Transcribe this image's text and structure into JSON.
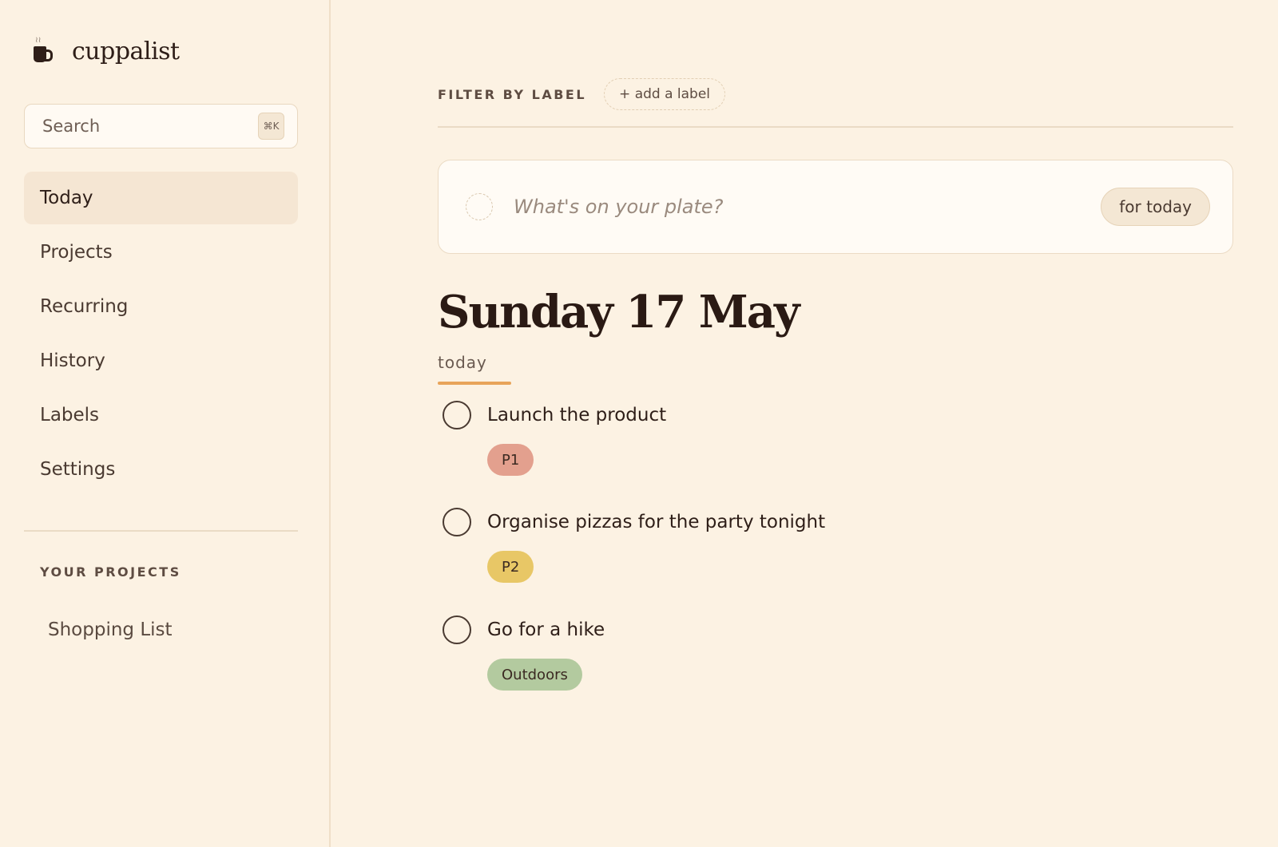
{
  "app": {
    "name": "cuppalist"
  },
  "search": {
    "placeholder": "Search",
    "shortcut": "⌘K"
  },
  "nav": {
    "items": [
      {
        "label": "Today",
        "active": true
      },
      {
        "label": "Projects"
      },
      {
        "label": "Recurring"
      },
      {
        "label": "History"
      },
      {
        "label": "Labels"
      },
      {
        "label": "Settings"
      }
    ]
  },
  "projects": {
    "title": "YOUR PROJECTS",
    "items": [
      {
        "label": "Shopping List"
      }
    ]
  },
  "filter": {
    "label": "FILTER BY LABEL",
    "add_label": "+ add a label"
  },
  "composer": {
    "placeholder": "What's on your plate?",
    "value": "",
    "button": "for today"
  },
  "day": {
    "heading": "Sunday 17 May",
    "subtitle": "today"
  },
  "tasks": [
    {
      "text": "Launch the product",
      "tag": "P1",
      "tag_color": "#e3a08e"
    },
    {
      "text": "Organise pizzas for the party tonight",
      "tag": "P2",
      "tag_color": "#e8c766"
    },
    {
      "text": "Go for a hike",
      "tag": "Outdoors",
      "tag_color": "#b3ca9f"
    }
  ],
  "colors": {
    "background": "#fcf2e3",
    "accent_underline": "#e8a45a"
  }
}
